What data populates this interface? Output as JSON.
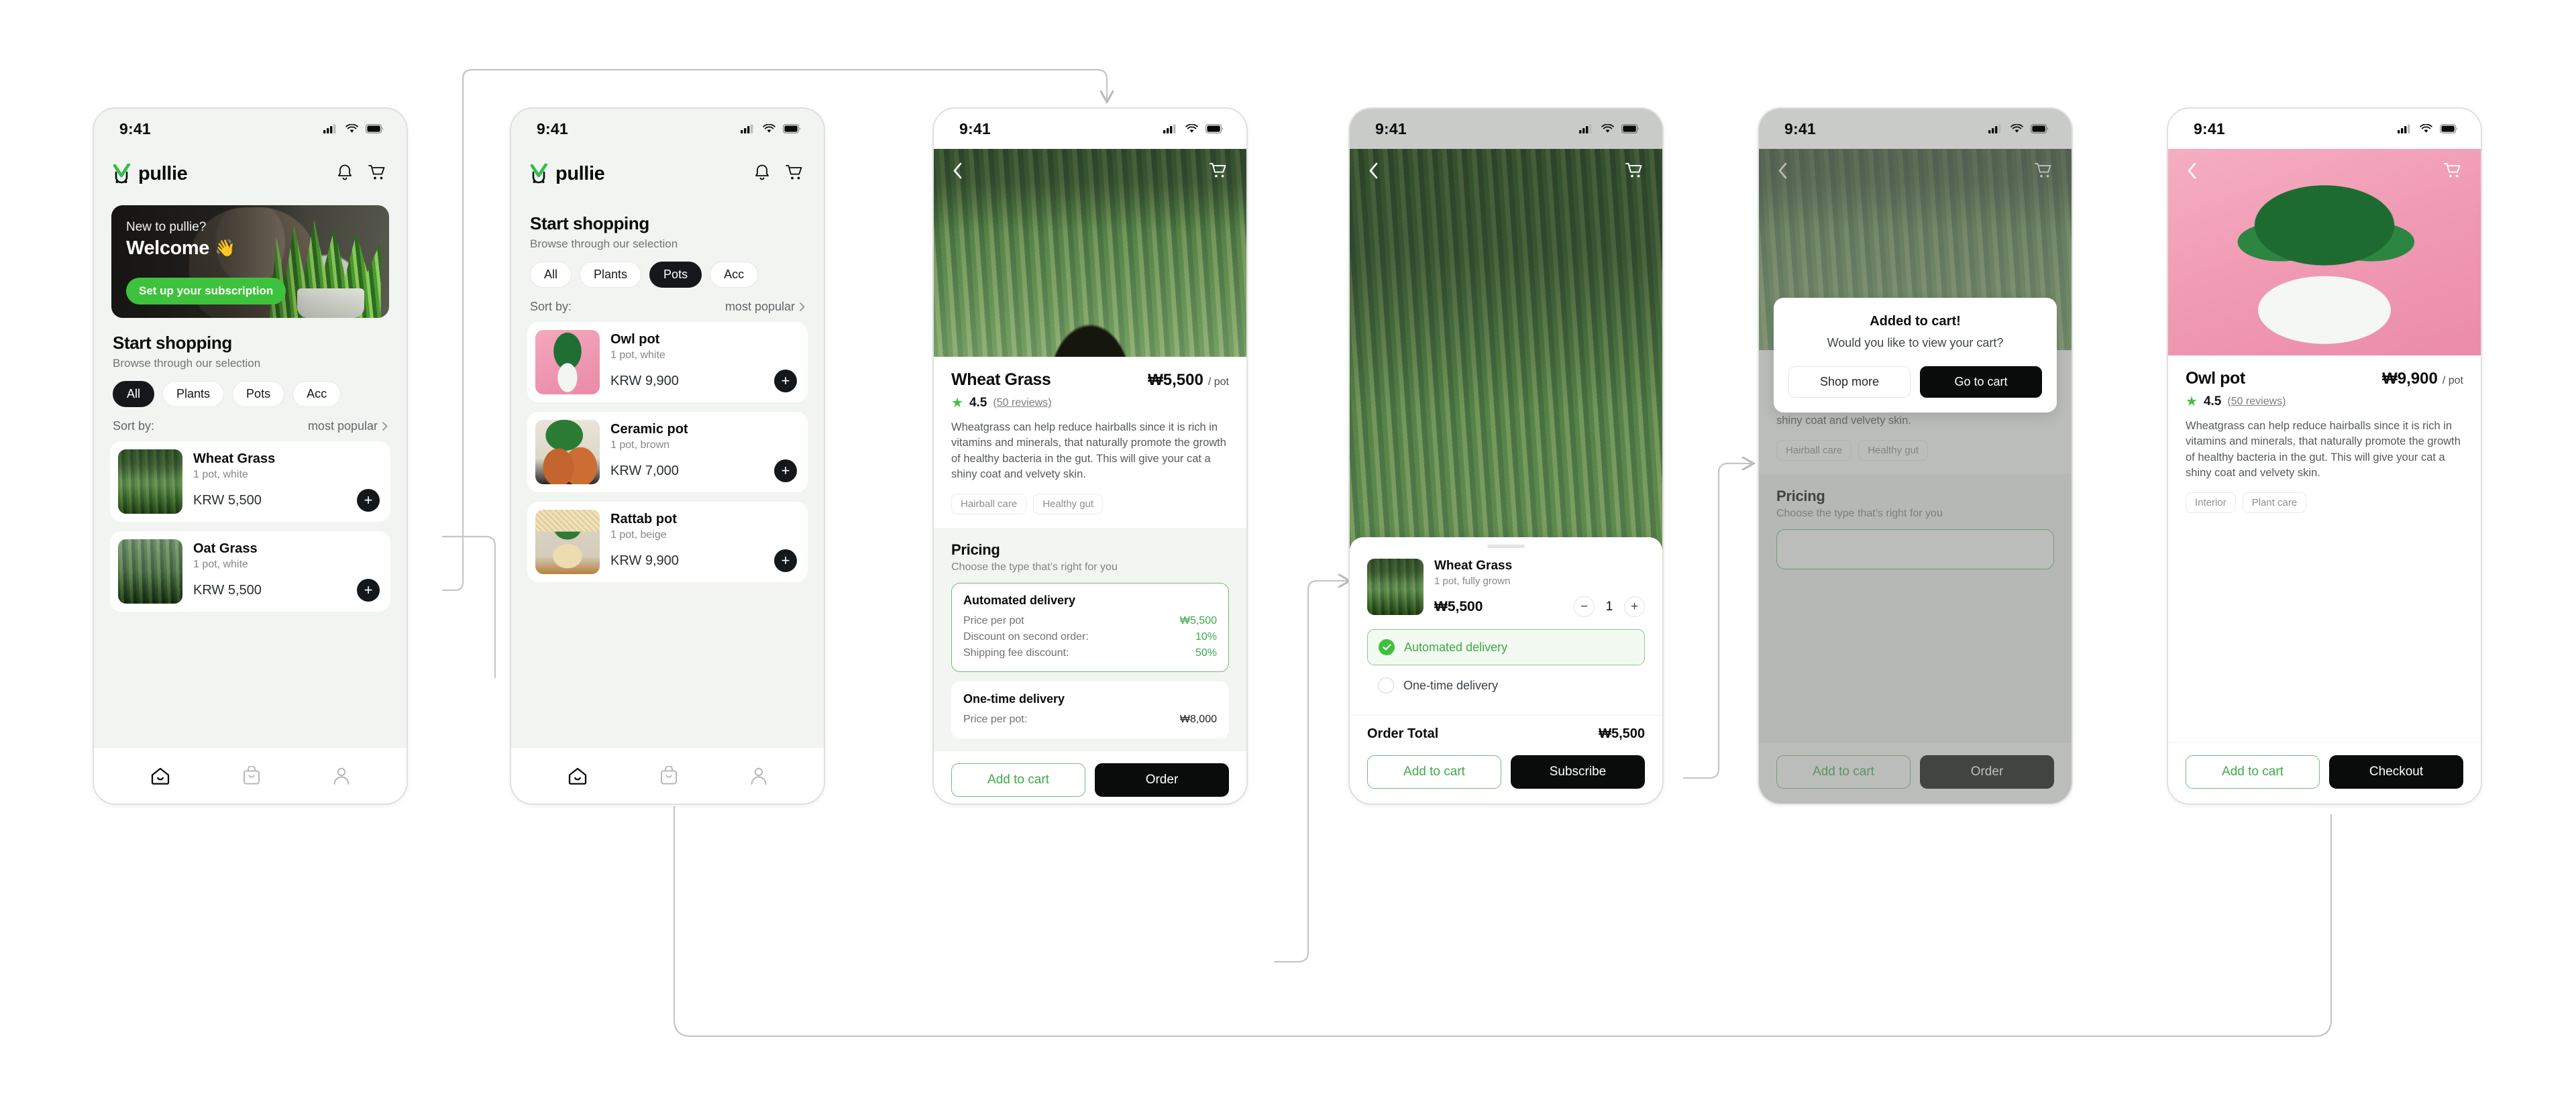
{
  "statusbar": {
    "time": "9:41"
  },
  "brand": {
    "name": "pullie"
  },
  "colors": {
    "accent_green": "#3EC23E",
    "dark": "#0A0C0B",
    "surface": "#F2F4F1",
    "price_green": "#3EA94A"
  },
  "screens": [
    {
      "id": "home",
      "banner": {
        "kicker": "New to pullie?",
        "title": "Welcome",
        "emoji": "👋",
        "cta": "Set up your subscription"
      },
      "section": {
        "title": "Start shopping",
        "subtitle": "Browse through our selection"
      },
      "chips": [
        {
          "label": "All",
          "active": true
        },
        {
          "label": "Plants",
          "active": false
        },
        {
          "label": "Pots",
          "active": false
        },
        {
          "label": "Acc",
          "active": false
        }
      ],
      "sort": {
        "label": "Sort by:",
        "value": "most popular"
      },
      "products": [
        {
          "name": "Wheat Grass",
          "sub": "1 pot, white",
          "price": "KRW 5,500",
          "image": "wheat-grass-photo"
        },
        {
          "name": "Oat Grass",
          "sub": "1 pot, white",
          "price": "KRW 5,500",
          "image": "oat-grass-photo"
        }
      ],
      "tabs": [
        "home-icon",
        "bag-icon",
        "profile-icon"
      ]
    },
    {
      "id": "catalog-pots",
      "section": {
        "title": "Start shopping",
        "subtitle": "Browse through our selection"
      },
      "chips": [
        {
          "label": "All",
          "active": false
        },
        {
          "label": "Plants",
          "active": false
        },
        {
          "label": "Pots",
          "active": true
        },
        {
          "label": "Acc",
          "active": false
        }
      ],
      "sort": {
        "label": "Sort by:",
        "value": "most popular"
      },
      "products": [
        {
          "name": "Owl pot",
          "sub": "1 pot, white",
          "price": "KRW 9,900",
          "image": "owl-pot-photo"
        },
        {
          "name": "Ceramic pot",
          "sub": "1 pot, brown",
          "price": "KRW 7,000",
          "image": "ceramic-pot-photo"
        },
        {
          "name": "Rattab pot",
          "sub": "1 pot, beige",
          "price": "KRW 9,900",
          "image": "rattab-pot-photo"
        }
      ],
      "tabs": [
        "home-icon",
        "bag-icon",
        "profile-icon"
      ]
    },
    {
      "id": "product-wheat-grass",
      "hero_image": "wheat-grass-photo",
      "title": "Wheat Grass",
      "price": "₩5,500",
      "unit": "/ pot",
      "rating": "4.5",
      "reviews": "(50 reviews)",
      "description": "Wheatgrass can help reduce hairballs since it is rich in vitamins and minerals, that naturally promote the growth of healthy bacteria in the gut. This will give your cat a shiny coat and velvety skin.",
      "tags": [
        "Hairball care",
        "Healthy gut"
      ],
      "pricing": {
        "title": "Pricing",
        "subtitle": "Choose the type that’s right for you",
        "options": [
          {
            "name": "Automated delivery",
            "selected": true,
            "rows": [
              {
                "label": "Price per pot",
                "value": "₩5,500",
                "tone": "green"
              },
              {
                "label": "Discount on second order:",
                "value": "10%",
                "tone": "green"
              },
              {
                "label": "Shipping fee discount:",
                "value": "50%",
                "tone": "green"
              }
            ]
          },
          {
            "name": "One-time delivery",
            "selected": false,
            "rows": [
              {
                "label": "Price per pot:",
                "value": "₩8,000",
                "tone": "dark"
              }
            ]
          }
        ]
      },
      "actions": {
        "secondary": "Add to cart",
        "primary": "Order"
      }
    },
    {
      "id": "order-sheet",
      "hero_image": "wheat-grass-photo",
      "sheet": {
        "product": {
          "name": "Wheat Grass",
          "sub": "1 pot, fully grown",
          "price": "₩5,500",
          "image": "wheat-grass-photo"
        },
        "quantity": "1",
        "stepper": {
          "decrement": "−",
          "increment": "+"
        },
        "delivery_options": [
          {
            "label": "Automated delivery",
            "selected": true
          },
          {
            "label": "One-time delivery",
            "selected": false
          }
        ],
        "total": {
          "label": "Order Total",
          "value": "₩5,500"
        },
        "actions": {
          "secondary": "Add to cart",
          "primary": "Subscribe"
        }
      }
    },
    {
      "id": "added-to-cart",
      "hero_image": "wheat-grass-photo",
      "modal": {
        "title": "Added to cart!",
        "subtitle": "Would you like to view your cart?",
        "secondary": "Shop more",
        "primary": "Go to cart"
      },
      "behind": {
        "description": "Wheatgrass can help reduce hairballs since it is rich in vitamins and minerals, that naturally promote the growth of healthy bacteria in the gut. This will give your cat a shiny coat and velvety skin.",
        "tags": [
          "Hairball care",
          "Healthy gut"
        ],
        "pricing_title": "Pricing",
        "pricing_subtitle": "Choose the type that’s right for you",
        "actions": {
          "secondary": "Add to cart",
          "primary": "Order"
        }
      }
    },
    {
      "id": "product-owl-pot",
      "hero_image": "owl-pot-photo",
      "title": "Owl pot",
      "price": "₩9,900",
      "unit": "/ pot",
      "rating": "4.5",
      "reviews": "(50 reviews)",
      "description": "Wheatgrass can help reduce hairballs since it is rich in vitamins and minerals, that naturally promote the growth of healthy bacteria in the gut. This will give your cat a shiny coat and velvety skin.",
      "tags": [
        "Interior",
        "Plant care"
      ],
      "actions": {
        "secondary": "Add to cart",
        "primary": "Checkout"
      }
    }
  ]
}
